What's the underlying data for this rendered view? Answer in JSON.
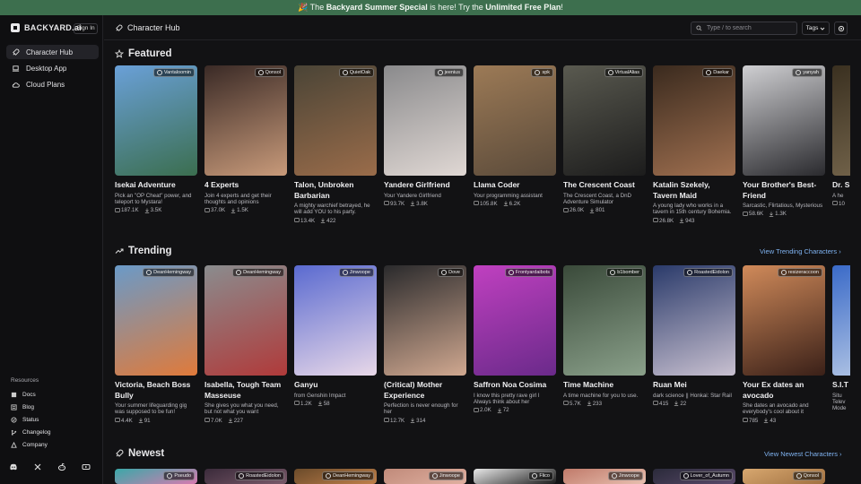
{
  "banner": {
    "pre": "🎉 The ",
    "strong1": "Backyard Summer Special",
    "mid": " is here! Try the ",
    "strong2": "Unlimited Free Plan",
    "post": "!"
  },
  "sidebar": {
    "brand": "BACKYARD.ai",
    "signin": "Sign In",
    "nav": [
      {
        "label": "Character Hub",
        "icon": "rocket-icon"
      },
      {
        "label": "Desktop App",
        "icon": "laptop-icon"
      },
      {
        "label": "Cloud Plans",
        "icon": "cloud-icon"
      }
    ],
    "resources_title": "Resources",
    "resources": [
      {
        "label": "Docs"
      },
      {
        "label": "Blog"
      },
      {
        "label": "Status"
      },
      {
        "label": "Changelog"
      },
      {
        "label": "Company"
      }
    ],
    "socials": [
      "discord-icon",
      "x-icon",
      "reddit-icon",
      "youtube-icon"
    ]
  },
  "topbar": {
    "title": "Character Hub",
    "search_placeholder": "Type / to search",
    "tags": "Tags"
  },
  "featured": {
    "title": "Featured",
    "cards": [
      {
        "author": "Vantaloomin",
        "name": "Isekai Adventure",
        "desc": "Pick an \"OP Cheat\" power, and teleport to Mystara!",
        "chats": "187.1K",
        "downloads": "3.5K",
        "colors": [
          "#6aa0d8",
          "#3b6e4f"
        ]
      },
      {
        "author": "Qonsol",
        "name": "4 Experts",
        "desc": "Join 4 experts and get their thoughts and opinions",
        "chats": "37.0K",
        "downloads": "1.5K",
        "colors": [
          "#3a2a26",
          "#c89a7a"
        ]
      },
      {
        "author": "QuietOak",
        "name": "Talon, Unbroken Barbarian",
        "desc": "A mighty warchief betrayed, he will add YOU to his party.",
        "chats": "13.4K",
        "downloads": "422",
        "colors": [
          "#4a4436",
          "#9a6c4a"
        ]
      },
      {
        "author": "jeenius",
        "name": "Yandere Girlfriend",
        "desc": "Your Yandere Girlfriend",
        "chats": "93.7K",
        "downloads": "3.8K",
        "colors": [
          "#8a8a8c",
          "#e0d8d4"
        ]
      },
      {
        "author": "spk",
        "name": "Llama Coder",
        "desc": "Your programming assistant",
        "chats": "105.8K",
        "downloads": "6.2K",
        "colors": [
          "#9c7a56",
          "#5a4a3a"
        ]
      },
      {
        "author": "VirtualAlias",
        "name": "The Crescent Coast",
        "desc": "The Crescent Coast, a DnD Adventure Simulator",
        "chats": "26.0K",
        "downloads": "801",
        "colors": [
          "#5a5a50",
          "#1c1c1c"
        ]
      },
      {
        "author": "Daekar",
        "name": "Katalin Szekely, Tavern Maid",
        "desc": "A young lady who works in a tavern in 15th century Bohemia.",
        "chats": "26.8K",
        "downloads": "943",
        "colors": [
          "#3a2a1e",
          "#a07050"
        ]
      },
      {
        "author": "yanyah",
        "name": "Your Brother's Best-Friend",
        "desc": "Sarcastic, Flirtatious, Mysterious",
        "chats": "58.6K",
        "downloads": "1.3K",
        "colors": [
          "#cfcfd2",
          "#2a2a2e"
        ]
      },
      {
        "author": "",
        "name": "Dr. S",
        "desc": "A he",
        "chats": "10",
        "downloads": "",
        "colors": [
          "#3a3020",
          "#7a6a50"
        ]
      }
    ]
  },
  "trending": {
    "title": "Trending",
    "view_all": "View Trending Characters ›",
    "cards": [
      {
        "author": "DeanHemingway",
        "name": "Victoria, Beach Boss Bully",
        "desc": "Your summer lifeguarding gig was supposed to be fun!",
        "chats": "4.4K",
        "downloads": "91",
        "colors": [
          "#6a9ac8",
          "#e07a3a"
        ]
      },
      {
        "author": "DeanHemingway",
        "name": "Isabella, Tough Team Masseuse",
        "desc": "She gives you what you need, but not what you want",
        "chats": "7.0K",
        "downloads": "227",
        "colors": [
          "#8a8c8e",
          "#b03a3a"
        ]
      },
      {
        "author": "Jinwoope",
        "name": "Ganyu",
        "desc": "from Genshin Impact",
        "chats": "1.2K",
        "downloads": "58",
        "colors": [
          "#5a6ad0",
          "#e8d8e8"
        ]
      },
      {
        "author": "Dove",
        "name": "(Critical) Mother Experience",
        "desc": "Perfection is never enough for her",
        "chats": "12.7K",
        "downloads": "314",
        "colors": [
          "#2a2a2c",
          "#d0a890"
        ]
      },
      {
        "author": "Frontyardaibots",
        "name": "Saffron Noa Cosima",
        "desc": "I know this pretty rave girl I Always think about her",
        "chats": "2.0K",
        "downloads": "72",
        "colors": [
          "#c040c0",
          "#6a2a8a"
        ]
      },
      {
        "author": "b1bomber",
        "name": "Time Machine",
        "desc": "A time machine for you to use.",
        "chats": "5.7K",
        "downloads": "233",
        "colors": [
          "#3a4a3a",
          "#8aa08a"
        ]
      },
      {
        "author": "RoastedEidolon",
        "name": "Ruan Mei",
        "desc": "dark science || Honkai: Star Rail",
        "chats": "415",
        "downloads": "22",
        "colors": [
          "#2a3a6a",
          "#c8c0d0"
        ]
      },
      {
        "author": "resizeraccoon",
        "name": "Your Ex dates an avocado",
        "desc": "She dates an avocado and everybody's cool about it",
        "chats": "785",
        "downloads": "43",
        "colors": [
          "#d08a5a",
          "#3a2018"
        ]
      },
      {
        "author": "",
        "name": "S.I.T",
        "desc": "Situ Telev Mode",
        "chats": "",
        "downloads": "",
        "colors": [
          "#3a6ac8",
          "#c0d0e8"
        ]
      }
    ]
  },
  "newest": {
    "title": "Newest",
    "view_all": "View Newest Characters ›",
    "cards": [
      {
        "author": "Pseudo",
        "colors": [
          "#3aa8a8",
          "#d87ab0"
        ]
      },
      {
        "author": "RoastedEidolon",
        "colors": [
          "#3a2a3a",
          "#7a5a6a"
        ]
      },
      {
        "author": "DeanHemingway",
        "colors": [
          "#6a4a2a",
          "#c0804a"
        ]
      },
      {
        "author": "Jinwoope",
        "colors": [
          "#c08a7a",
          "#e0b0a0"
        ]
      },
      {
        "author": "Flico",
        "colors": [
          "#e8e8e8",
          "#1a1a1a"
        ]
      },
      {
        "author": "Jinwoope",
        "colors": [
          "#c07a6a",
          "#e8c0b0"
        ]
      },
      {
        "author": "Lover_of_Autumn",
        "colors": [
          "#2a2a3a",
          "#5a4a6a"
        ]
      },
      {
        "author": "Qonsol",
        "colors": [
          "#d8a870",
          "#a07040"
        ]
      }
    ]
  }
}
